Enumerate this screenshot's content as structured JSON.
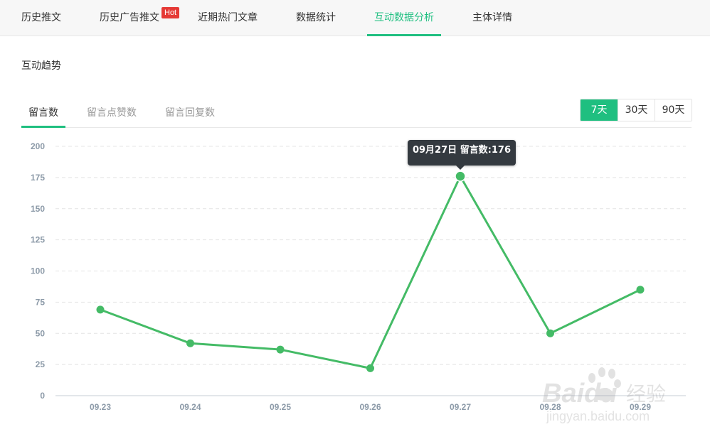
{
  "nav": {
    "tabs": [
      {
        "label": "历史推文"
      },
      {
        "label": "历史广告推文",
        "badge": "Hot"
      },
      {
        "label": "近期热门文章"
      },
      {
        "label": "数据统计"
      },
      {
        "label": "互动数据分析",
        "active": true
      },
      {
        "label": "主体详情"
      }
    ],
    "accent_color": "#1fbf80",
    "badge_color": "#e53935"
  },
  "section": {
    "title": "互动趋势"
  },
  "subtabs": [
    {
      "label": "留言数",
      "active": true
    },
    {
      "label": "留言点赞数"
    },
    {
      "label": "留言回复数"
    }
  ],
  "range_buttons": [
    {
      "label": "7天",
      "active": true
    },
    {
      "label": "30天"
    },
    {
      "label": "90天"
    }
  ],
  "tooltip": {
    "text": "09月27日 留言数:176"
  },
  "watermark": {
    "brand": "Baidu",
    "brand_cn": "经验",
    "url": "jingyan.baidu.com"
  },
  "chart_data": {
    "type": "line",
    "categories": [
      "09.23",
      "09.24",
      "09.25",
      "09.26",
      "09.27",
      "09.28",
      "09.29"
    ],
    "series": [
      {
        "values": [
          69,
          42,
          37,
          22,
          176,
          50,
          85
        ],
        "color": "#44bb66"
      }
    ],
    "yticks": [
      "0",
      "25",
      "50",
      "75",
      "100",
      "125",
      "150",
      "175",
      "200"
    ],
    "ylim": [
      0,
      200
    ],
    "grid": "horizontal dashed",
    "highlight_index": 4
  }
}
